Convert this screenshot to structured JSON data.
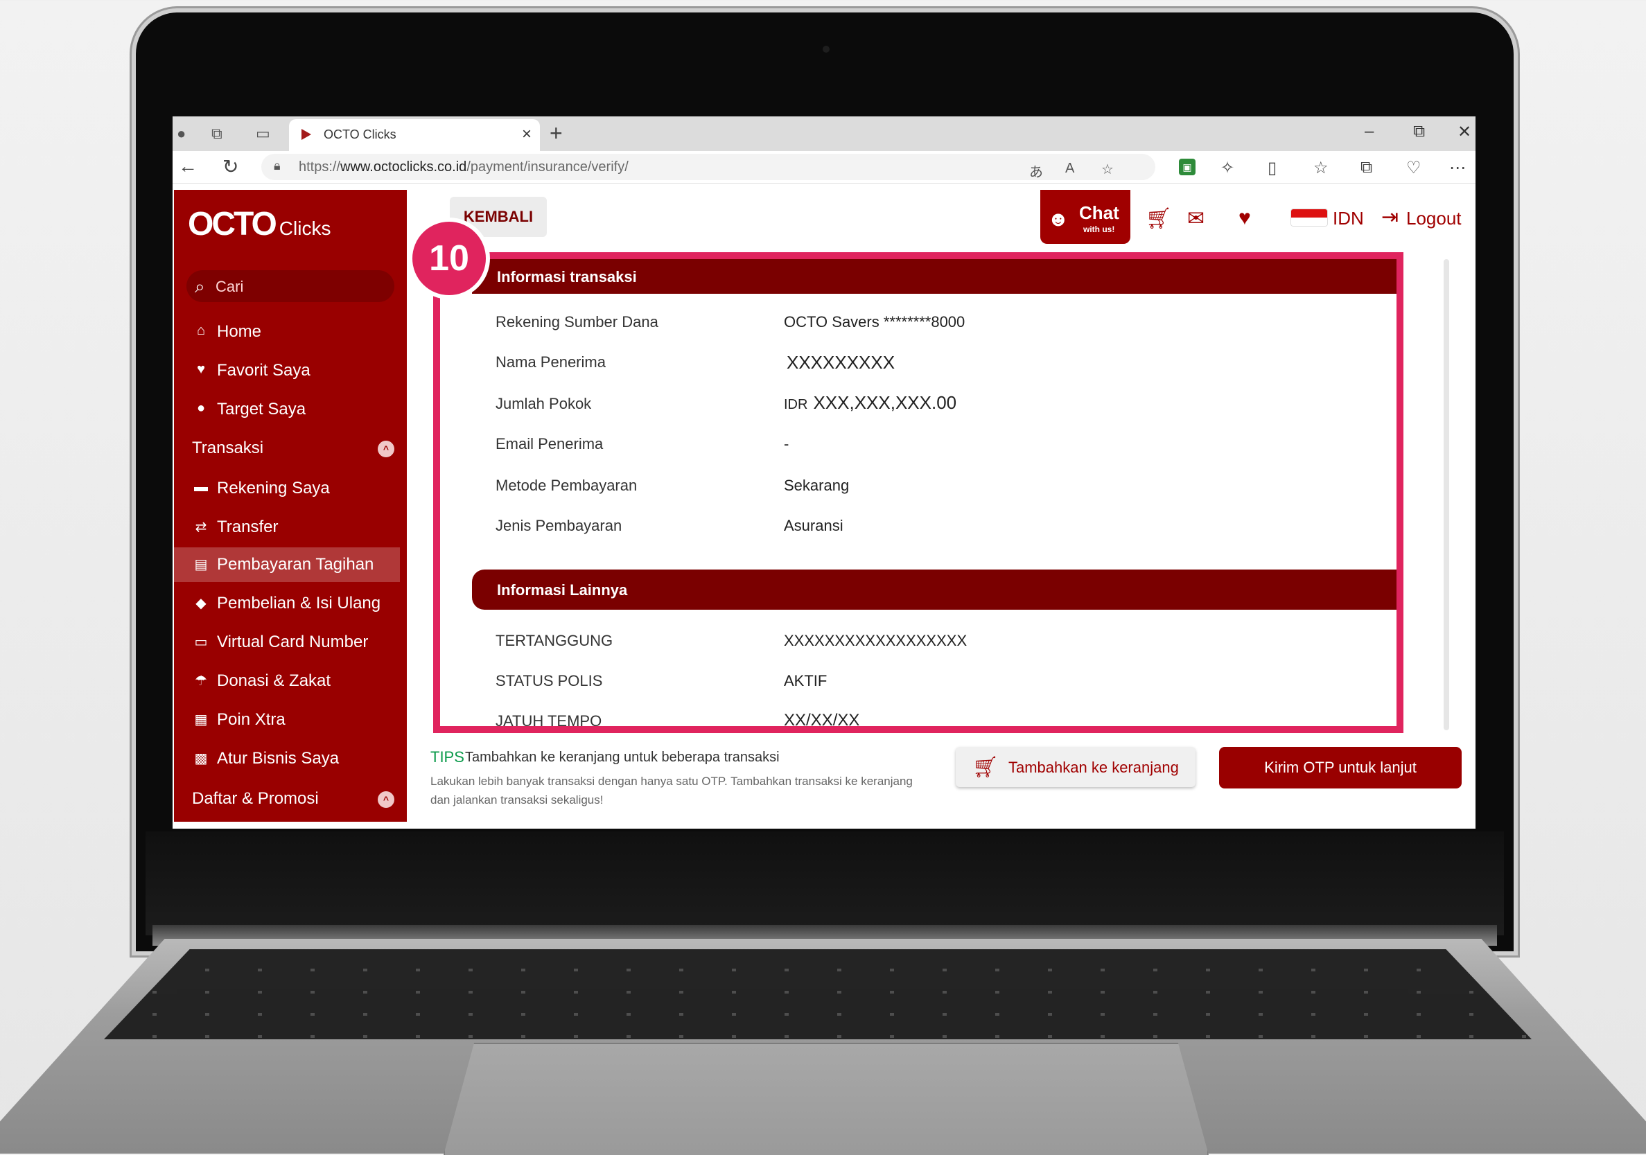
{
  "browser": {
    "tab_title": "OCTO Clicks",
    "tab_close": "×",
    "new_tab": "+",
    "url_prefix": "https://",
    "url_domain": "www.octoclicks.co.id",
    "url_path": "/payment/insurance/verify/",
    "minimize": "–",
    "restore": "⧉",
    "close": "✕"
  },
  "sidebar": {
    "logo_main": "OCTO",
    "logo_sub": "Clicks",
    "search_placeholder": "Cari",
    "items": [
      {
        "label": "Home"
      },
      {
        "label": "Favorit Saya"
      },
      {
        "label": "Target Saya"
      },
      {
        "label": "Transaksi"
      },
      {
        "label": "Rekening Saya"
      },
      {
        "label": "Transfer"
      },
      {
        "label": "Pembayaran Tagihan"
      },
      {
        "label": "Pembelian & Isi Ulang"
      },
      {
        "label": "Virtual Card Number"
      },
      {
        "label": "Donasi & Zakat"
      },
      {
        "label": "Poin Xtra"
      },
      {
        "label": "Atur Bisnis Saya"
      },
      {
        "label": "Daftar & Promosi"
      }
    ]
  },
  "header": {
    "back_label": "KEMBALI",
    "chat_label": "Chat",
    "chat_sub": "with us!",
    "language": "IDN",
    "logout_label": "Logout"
  },
  "step": "10",
  "transaction": {
    "title": "Informasi transaksi",
    "rows": [
      {
        "label": "Rekening Sumber Dana",
        "value": "OCTO Savers ********8000"
      },
      {
        "label": "Nama Penerima",
        "value": "XXXXXXXXX"
      },
      {
        "label": "Jumlah Pokok",
        "currency": "IDR",
        "value": "XXX,XXX,XXX.00"
      },
      {
        "label": "Email Penerima",
        "value": "-"
      },
      {
        "label": "Metode Pembayaran",
        "value": "Sekarang"
      },
      {
        "label": "Jenis Pembayaran",
        "value": "Asuransi"
      }
    ]
  },
  "other": {
    "title": "Informasi Lainnya",
    "rows": [
      {
        "label": "TERTANGGUNG",
        "value": "XXXXXXXXXXXXXXXXXX"
      },
      {
        "label": "STATUS POLIS",
        "value": "AKTIF"
      },
      {
        "label": "JATUH TEMPO",
        "value": "XX/XX/XX"
      }
    ]
  },
  "footer": {
    "tips_label": "TIPS",
    "tips_title": "Tambahkan ke keranjang untuk beberapa transaksi",
    "tips_desc": "Lakukan lebih banyak transaksi dengan hanya satu OTP. Tambahkan transaksi ke keranjang dan jalankan transaksi sekaligus!",
    "cart_button": "Tambahkan ke keranjang",
    "otp_button": "Kirim OTP untuk lanjut"
  },
  "colors": {
    "brand_red": "#990000",
    "dark_red": "#7a0000",
    "highlight_pink": "#e0245e",
    "tips_green": "#0a9a4a"
  },
  "icons": [
    "profile-icon",
    "collections-icon",
    "tab-actions-icon",
    "back-icon",
    "refresh-icon",
    "lock-icon",
    "translate-icon",
    "read-aloud-icon",
    "star-icon",
    "extensions-icon",
    "split-screen-icon",
    "favorites-icon",
    "collections-icon",
    "health-icon",
    "more-icon",
    "search-icon",
    "home-icon",
    "heart-icon",
    "target-icon",
    "card-icon",
    "transfer-icon",
    "bill-icon",
    "tag-icon",
    "donation-icon",
    "gift-icon",
    "briefcase-icon",
    "chevron-up-icon",
    "cart-icon",
    "mail-icon",
    "flag-icon",
    "logout-icon",
    "chat-agent-icon"
  ]
}
